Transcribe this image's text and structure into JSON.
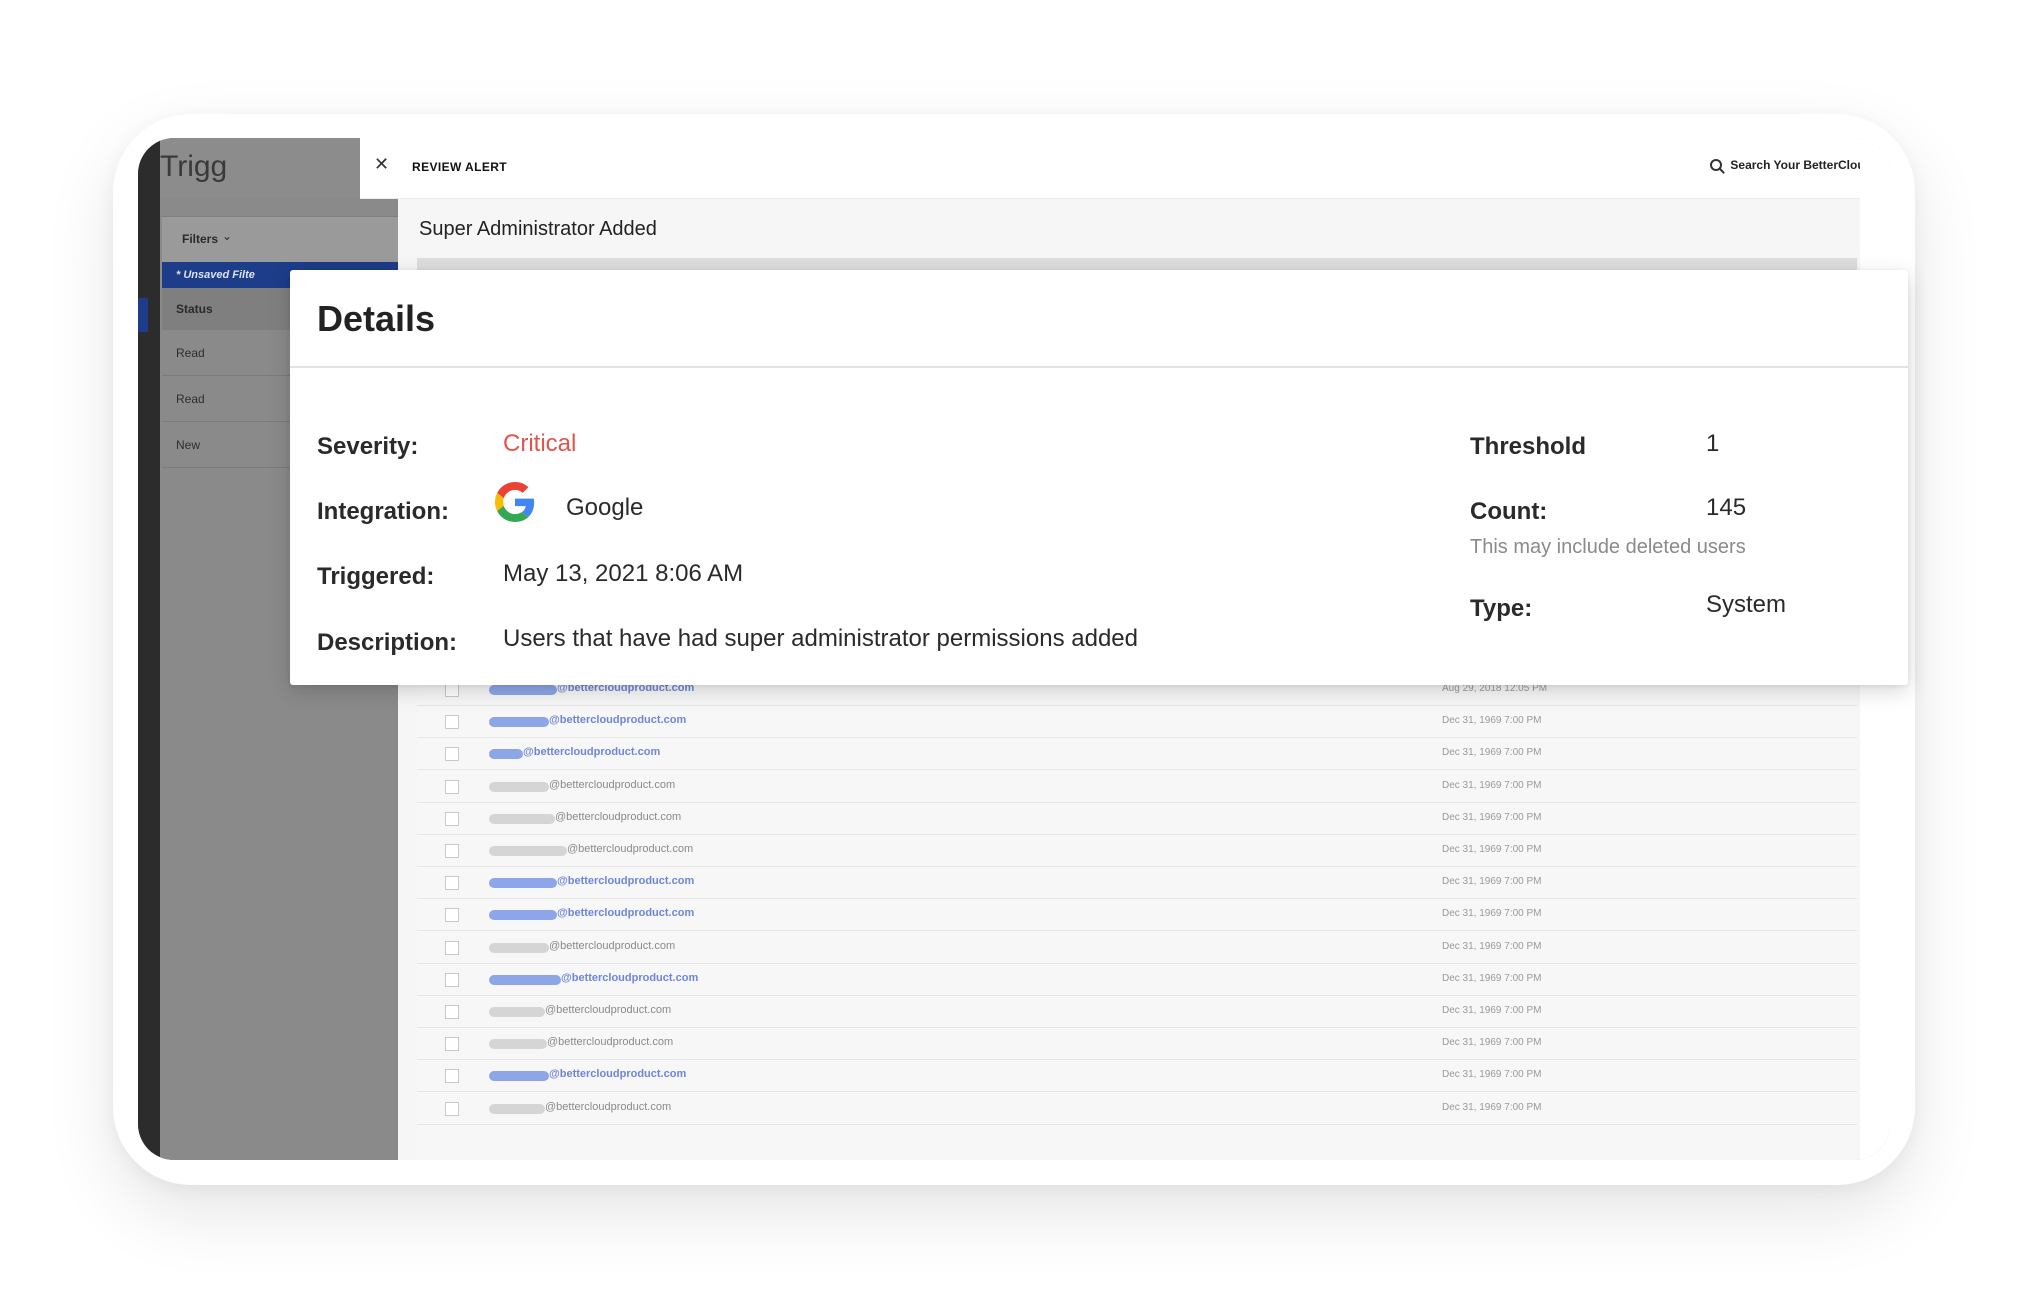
{
  "background": {
    "app_title_partial": "Trigg",
    "filters_label": "Filters",
    "unsaved_filter": "* Unsaved Filte",
    "status_column": "Status",
    "status_values": [
      "Read",
      "Read",
      "New"
    ]
  },
  "topbar": {
    "review_label": "REVIEW ALERT",
    "search_label": "Search Your BetterCloud"
  },
  "alert": {
    "title": "Super Administrator Added"
  },
  "details": {
    "title": "Details",
    "severity_label": "Severity:",
    "severity_value": "Critical",
    "integration_label": "Integration:",
    "integration_value": "Google",
    "triggered_label": "Triggered:",
    "triggered_value": "May 13, 2021 8:06 AM",
    "description_label": "Description:",
    "description_value": "Users that have had super administrator permissions added",
    "threshold_label": "Threshold",
    "threshold_value": "1",
    "count_label": "Count:",
    "count_value": "145",
    "count_note": "This may include deleted users",
    "type_label": "Type:",
    "type_value": "System"
  },
  "colors": {
    "critical": "#e4534c",
    "link_blue": "#6d86d8"
  },
  "icons": {
    "close": "close-icon",
    "search": "search-icon",
    "integration": "google-icon"
  },
  "users_table": {
    "rows": [
      {
        "domain": "@bettercloudproduct.com",
        "highlighted": true,
        "date": "Aug 29, 2018 12:05 PM"
      },
      {
        "domain": "@bettercloudproduct.com",
        "highlighted": true,
        "date": "Dec 31, 1969 7:00 PM"
      },
      {
        "domain": "@bettercloudproduct.com",
        "highlighted": true,
        "date": "Dec 31, 1969 7:00 PM"
      },
      {
        "domain": "@bettercloudproduct.com",
        "highlighted": false,
        "date": "Dec 31, 1969 7:00 PM"
      },
      {
        "domain": "@bettercloudproduct.com",
        "highlighted": false,
        "date": "Dec 31, 1969 7:00 PM"
      },
      {
        "domain": "@bettercloudproduct.com",
        "highlighted": false,
        "date": "Dec 31, 1969 7:00 PM"
      },
      {
        "domain": "@bettercloudproduct.com",
        "highlighted": true,
        "date": "Dec 31, 1969 7:00 PM"
      },
      {
        "domain": "@bettercloudproduct.com",
        "highlighted": true,
        "date": "Dec 31, 1969 7:00 PM"
      },
      {
        "domain": "@bettercloudproduct.com",
        "highlighted": false,
        "date": "Dec 31, 1969 7:00 PM"
      },
      {
        "domain": "@bettercloudproduct.com",
        "highlighted": true,
        "date": "Dec 31, 1969 7:00 PM"
      },
      {
        "domain": "@bettercloudproduct.com",
        "highlighted": false,
        "date": "Dec 31, 1969 7:00 PM"
      },
      {
        "domain": "@bettercloudproduct.com",
        "highlighted": false,
        "date": "Dec 31, 1969 7:00 PM"
      },
      {
        "domain": "@bettercloudproduct.com",
        "highlighted": true,
        "date": "Dec 31, 1969 7:00 PM"
      },
      {
        "domain": "@bettercloudproduct.com",
        "highlighted": false,
        "date": "Dec 31, 1969 7:00 PM"
      }
    ]
  }
}
